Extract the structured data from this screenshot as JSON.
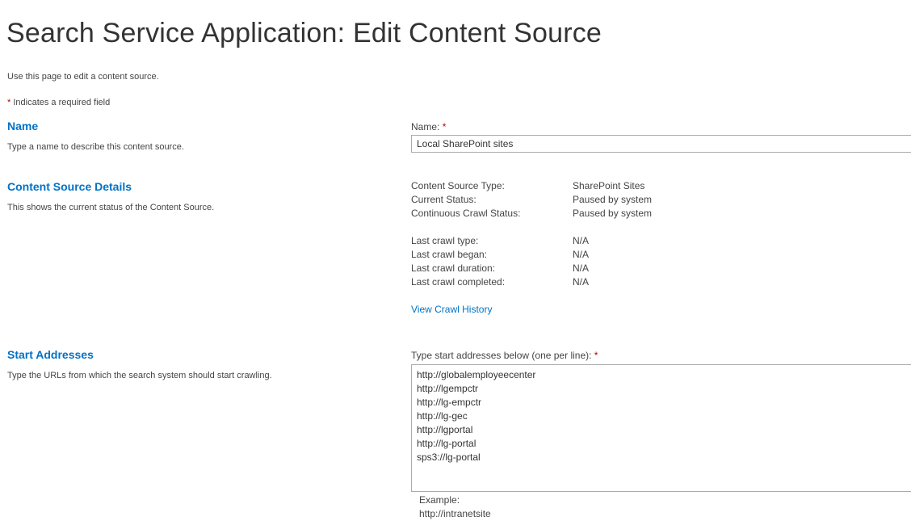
{
  "page": {
    "title": "Search Service Application: Edit Content Source",
    "description": "Use this page to edit a content source.",
    "required_note_star": "*",
    "required_note_text": " Indicates a required field"
  },
  "name_section": {
    "title": "Name",
    "description": "Type a name to describe this content source.",
    "field_label": "Name: ",
    "required_star": "*",
    "value": "Local SharePoint sites"
  },
  "details_section": {
    "title": "Content Source Details",
    "description": "This shows the current status of the Content Source.",
    "status_rows": [
      {
        "label": "Content Source Type:",
        "value": "SharePoint Sites"
      },
      {
        "label": "Current Status:",
        "value": "Paused by system"
      },
      {
        "label": "Continuous Crawl Status:",
        "value": "Paused by system"
      }
    ],
    "crawl_rows": [
      {
        "label": "Last crawl type:",
        "value": "N/A"
      },
      {
        "label": "Last crawl began:",
        "value": "N/A"
      },
      {
        "label": "Last crawl duration:",
        "value": "N/A"
      },
      {
        "label": "Last crawl completed:",
        "value": "N/A"
      }
    ],
    "history_link": "View Crawl History"
  },
  "start_addresses_section": {
    "title": "Start Addresses",
    "description": "Type the URLs from which the search system should start crawling.",
    "field_label": "Type start addresses below (one per line): ",
    "required_star": "*",
    "addresses": [
      "http://globalemployeecenter",
      "http://lgempctr",
      "http://lg-empctr",
      "http://lg-gec",
      "http://lgportal",
      "http://lg-portal",
      "sps3://lg-portal"
    ],
    "example_label": "Example:",
    "example_value": "http://intranetsite"
  },
  "colors": {
    "accent": "#0072c6",
    "required": "#bf0000",
    "text": "#444444"
  }
}
